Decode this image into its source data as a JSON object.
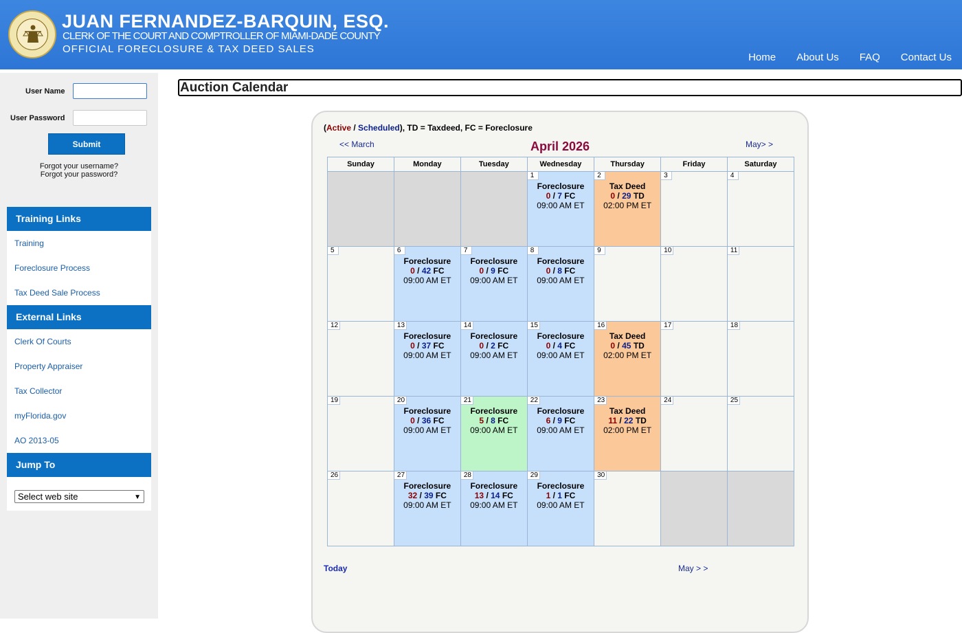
{
  "header": {
    "name": "JUAN FERNANDEZ-BARQUIN, ESQ.",
    "subtitle1": "CLERK OF THE COURT AND COMPTROLLER OF MIAMI-DADE COUNTY",
    "subtitle2": "OFFICIAL FORECLOSURE & TAX DEED SALES",
    "nav": [
      "Home",
      "About Us",
      "FAQ",
      "Contact Us"
    ]
  },
  "login": {
    "username_label": "User Name",
    "password_label": "User Password",
    "username_value": "",
    "password_value": "",
    "submit_label": "Submit",
    "forgot_username": "Forgot your username?",
    "forgot_password": "Forgot your password?"
  },
  "training": {
    "title": "Training Links",
    "links": [
      "Training",
      "Foreclosure Process",
      "Tax Deed Sale Process"
    ]
  },
  "external": {
    "title": "External Links",
    "links": [
      "Clerk Of Courts",
      "Property Appraiser",
      "Tax Collector",
      "myFlorida.gov",
      "AO 2013-05"
    ]
  },
  "jump": {
    "title": "Jump To",
    "selected": "Select web site"
  },
  "page_title": "Auction Calendar",
  "calendar": {
    "legend": {
      "open": "(",
      "active": "Active",
      "sep": " / ",
      "scheduled": "Scheduled",
      "rest": "), TD = Taxdeed, FC = Foreclosure"
    },
    "prev_label": "<< March",
    "next_label": "May> >",
    "month_title": "April 2026",
    "weekdays": [
      "Sunday",
      "Monday",
      "Tuesday",
      "Wednesday",
      "Thursday",
      "Friday",
      "Saturday"
    ],
    "weeks": [
      [
        {
          "day": "",
          "type": "blank"
        },
        {
          "day": "",
          "type": "blank"
        },
        {
          "day": "",
          "type": "blank"
        },
        {
          "day": "1",
          "type": "fc",
          "event": "Foreclosure",
          "active": "0",
          "scheduled": "7",
          "kind": "FC",
          "time": "09:00 AM ET"
        },
        {
          "day": "2",
          "type": "td",
          "event": "Tax Deed",
          "active": "0",
          "scheduled": "29",
          "kind": "TD",
          "time": "02:00 PM ET"
        },
        {
          "day": "3",
          "type": "none"
        },
        {
          "day": "4",
          "type": "none"
        }
      ],
      [
        {
          "day": "5",
          "type": "none"
        },
        {
          "day": "6",
          "type": "fc",
          "event": "Foreclosure",
          "active": "0",
          "scheduled": "42",
          "kind": "FC",
          "time": "09:00 AM ET"
        },
        {
          "day": "7",
          "type": "fc",
          "event": "Foreclosure",
          "active": "0",
          "scheduled": "9",
          "kind": "FC",
          "time": "09:00 AM ET"
        },
        {
          "day": "8",
          "type": "fc",
          "event": "Foreclosure",
          "active": "0",
          "scheduled": "8",
          "kind": "FC",
          "time": "09:00 AM ET"
        },
        {
          "day": "9",
          "type": "none"
        },
        {
          "day": "10",
          "type": "none"
        },
        {
          "day": "11",
          "type": "none"
        }
      ],
      [
        {
          "day": "12",
          "type": "none"
        },
        {
          "day": "13",
          "type": "fc",
          "event": "Foreclosure",
          "active": "0",
          "scheduled": "37",
          "kind": "FC",
          "time": "09:00 AM ET"
        },
        {
          "day": "14",
          "type": "fc",
          "event": "Foreclosure",
          "active": "0",
          "scheduled": "2",
          "kind": "FC",
          "time": "09:00 AM ET"
        },
        {
          "day": "15",
          "type": "fc",
          "event": "Foreclosure",
          "active": "0",
          "scheduled": "4",
          "kind": "FC",
          "time": "09:00 AM ET"
        },
        {
          "day": "16",
          "type": "td",
          "event": "Tax Deed",
          "active": "0",
          "scheduled": "45",
          "kind": "TD",
          "time": "02:00 PM ET"
        },
        {
          "day": "17",
          "type": "none"
        },
        {
          "day": "18",
          "type": "none"
        }
      ],
      [
        {
          "day": "19",
          "type": "none"
        },
        {
          "day": "20",
          "type": "fc",
          "event": "Foreclosure",
          "active": "0",
          "scheduled": "36",
          "kind": "FC",
          "time": "09:00 AM ET"
        },
        {
          "day": "21",
          "type": "fcg",
          "event": "Foreclosure",
          "active": "5",
          "scheduled": "8",
          "kind": "FC",
          "time": "09:00 AM ET"
        },
        {
          "day": "22",
          "type": "fc",
          "event": "Foreclosure",
          "active": "6",
          "scheduled": "9",
          "kind": "FC",
          "time": "09:00 AM ET"
        },
        {
          "day": "23",
          "type": "td",
          "event": "Tax Deed",
          "active": "11",
          "scheduled": "22",
          "kind": "TD",
          "time": "02:00 PM ET"
        },
        {
          "day": "24",
          "type": "none"
        },
        {
          "day": "25",
          "type": "none"
        }
      ],
      [
        {
          "day": "26",
          "type": "none"
        },
        {
          "day": "27",
          "type": "fc",
          "event": "Foreclosure",
          "active": "32",
          "scheduled": "39",
          "kind": "FC",
          "time": "09:00 AM ET"
        },
        {
          "day": "28",
          "type": "fc",
          "event": "Foreclosure",
          "active": "13",
          "scheduled": "14",
          "kind": "FC",
          "time": "09:00 AM ET"
        },
        {
          "day": "29",
          "type": "fc",
          "event": "Foreclosure",
          "active": "1",
          "scheduled": "1",
          "kind": "FC",
          "time": "09:00 AM ET"
        },
        {
          "day": "30",
          "type": "none"
        },
        {
          "day": "",
          "type": "blank"
        },
        {
          "day": "",
          "type": "blank"
        }
      ]
    ],
    "today_label": "Today",
    "bottom_next_label": "May > >"
  }
}
